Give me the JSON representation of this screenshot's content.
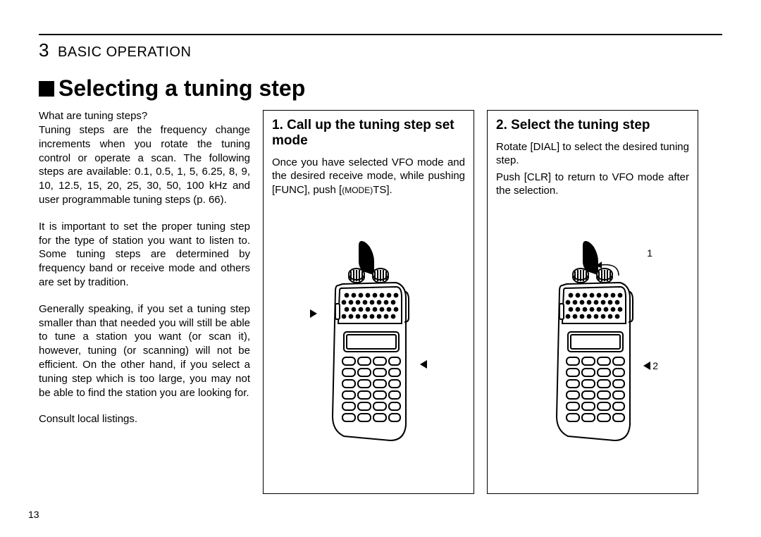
{
  "chapter": {
    "number": "3",
    "label": "BASIC OPERATION"
  },
  "title": "Selecting a tuning step",
  "intro": {
    "question": "What are tuning steps?",
    "p1": "Tuning steps are the frequency change increments when you rotate the tuning control or operate a scan. The following steps are available: 0.1, 0.5, 1, 5, 6.25, 8, 9, 10, 12.5, 15, 20, 25, 30, 50, 100 kHz and user programmable tuning steps (p. 66).",
    "p2": "It is important to set the proper tuning step for the type of station you want to listen to. Some tuning steps are determined by frequency band or receive mode and others are set by tradition.",
    "p3": "Generally speaking, if you set a tuning step smaller than that needed you will still be able to tune a station you want (or scan it), however, tuning (or scanning) will not be efficient. On the other hand, if you select a tuning step which is too large, you may not be able to find the station you are looking for.",
    "p4": "Consult local listings."
  },
  "step1": {
    "title": "1. Call up the tuning step set mode",
    "text_a": "Once you have selected VFO mode and the desired receive mode, while pushing [FUNC], push [",
    "text_mode": "(MODE)",
    "text_b": "TS]."
  },
  "step2": {
    "title": "2. Select the tuning step",
    "text1": "Rotate [DIAL] to select the desired tuning step.",
    "text2": "Push [CLR] to return to VFO mode after the selection.",
    "callout1": "1",
    "callout2": "2"
  },
  "pagenum": "13"
}
